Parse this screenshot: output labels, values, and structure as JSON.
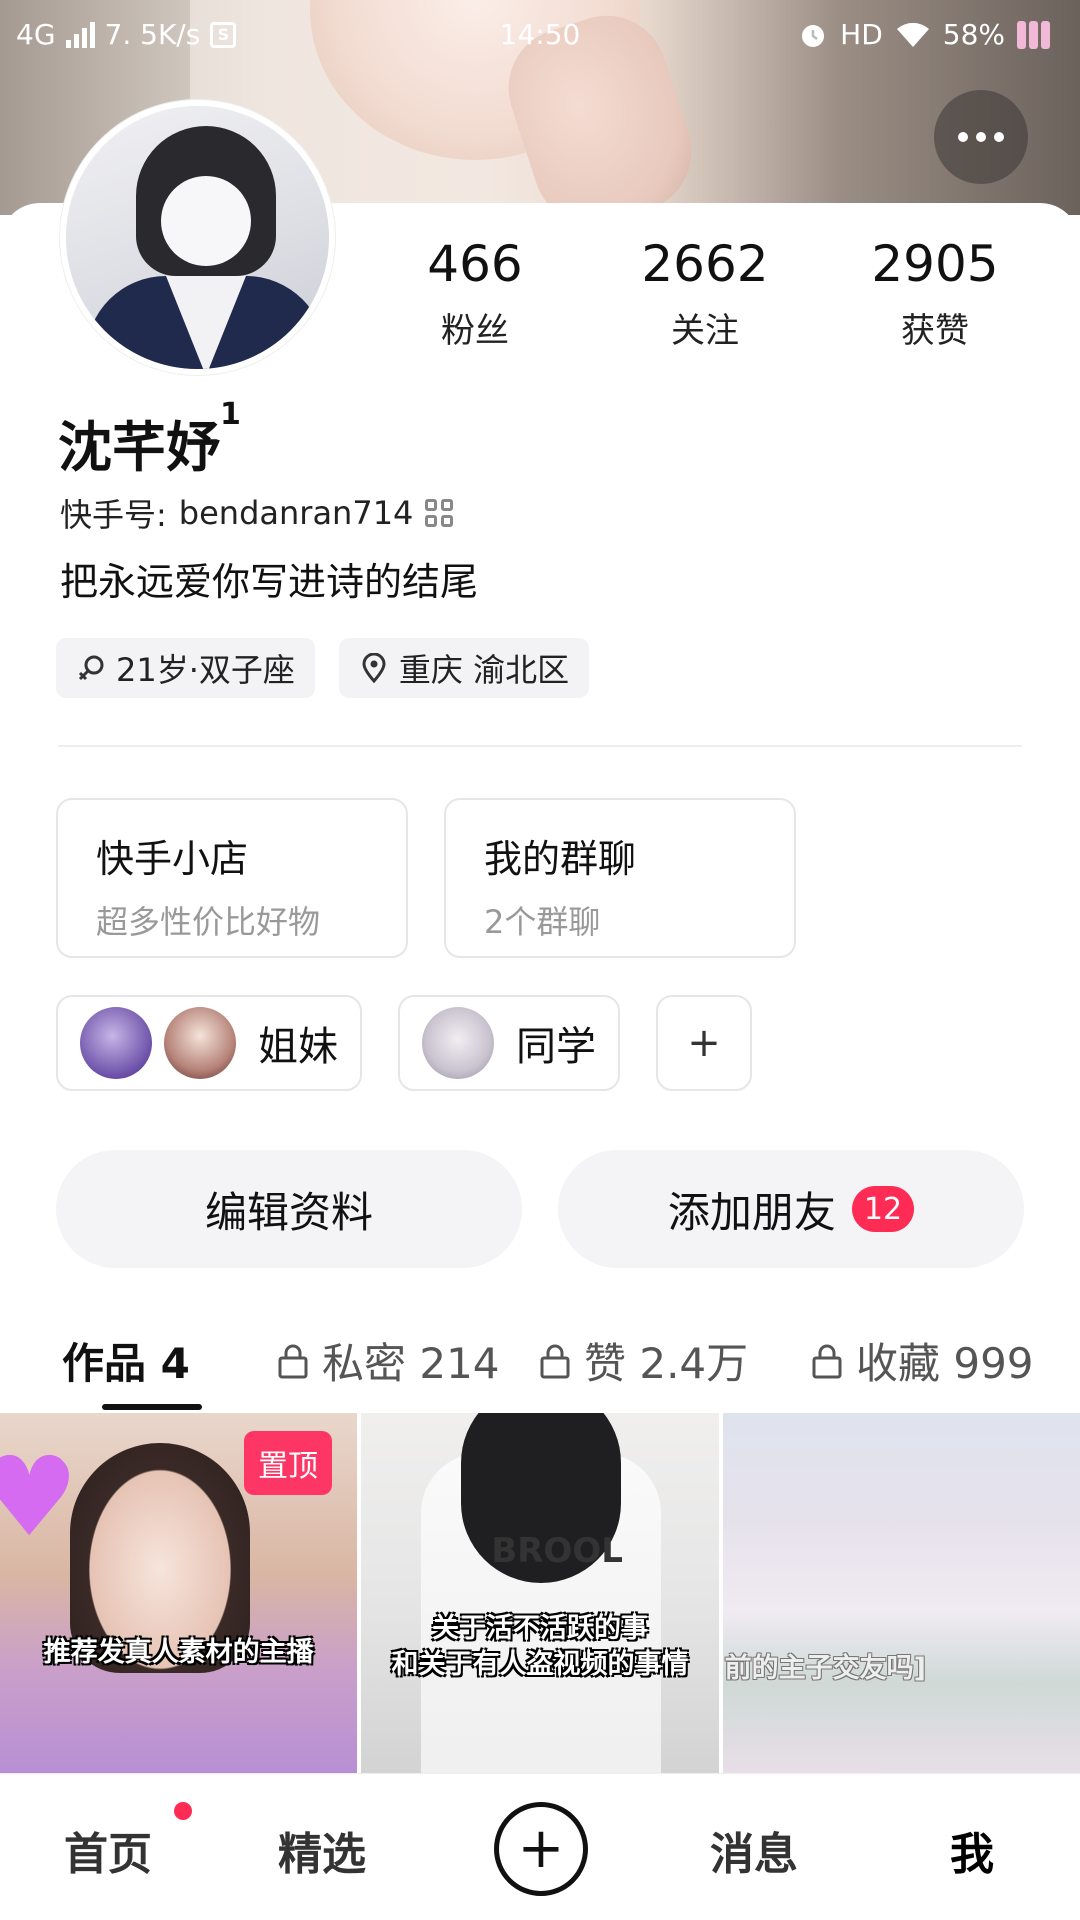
{
  "status_bar": {
    "network": "4G",
    "speed": "7. 5K/s",
    "time": "14:50",
    "hd": "HD",
    "battery": "58%"
  },
  "profile": {
    "name": "沈芊妤",
    "name_suffix": "1",
    "kuaishou_id_label": "快手号:",
    "kuaishou_id": "bendanran714",
    "bio": "把永远爱你写进诗的结尾",
    "tags": [
      {
        "icon": "gender-icon",
        "text": "21岁·双子座"
      },
      {
        "icon": "location-pin-icon",
        "text": "重庆 渝北区"
      }
    ]
  },
  "stats": [
    {
      "value": "466",
      "label": "粉丝"
    },
    {
      "value": "2662",
      "label": "关注"
    },
    {
      "value": "2905",
      "label": "获赞"
    }
  ],
  "shortcuts": [
    {
      "title": "快手小店",
      "subtitle": "超多性价比好物"
    },
    {
      "title": "我的群聊",
      "subtitle": "2个群聊"
    }
  ],
  "groups": [
    {
      "label": "姐妹"
    },
    {
      "label": "同学"
    }
  ],
  "group_add": "+",
  "actions": {
    "edit": "编辑资料",
    "add_friend": "添加朋友",
    "add_friend_badge": "12"
  },
  "tabs": {
    "works": "作品 4",
    "private": "私密 214",
    "likes": "赞 2.4万",
    "favorites": "收藏 999"
  },
  "videos": [
    {
      "pinned_label": "置顶",
      "caption": "推荐发真人素材的主播"
    },
    {
      "caption_line1": "关于活不活跃的事",
      "caption_line2": "和关于有人盗视频的事情",
      "shirt_text": "BROOL"
    },
    {
      "caption": "前的主子交友吗]"
    }
  ],
  "bottom_nav": {
    "home": "首页",
    "featured": "精选",
    "create": "+",
    "messages": "消息",
    "me": "我"
  },
  "colors": {
    "accent": "#fe2c55",
    "pin": "#fe3666"
  }
}
